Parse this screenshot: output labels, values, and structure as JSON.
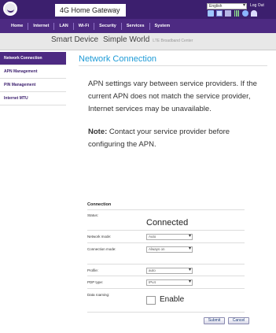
{
  "header": {
    "product_title": "4G Home Gateway",
    "language": "English",
    "logout": "Log Out",
    "status_icons": [
      "sim-icon",
      "mail-icon",
      "sd-icon",
      "signal-icon",
      "globe-icon",
      "wifi-icon"
    ]
  },
  "nav": {
    "items": [
      "Home",
      "Internet",
      "LAN",
      "Wi-Fi",
      "Security",
      "Services",
      "System"
    ],
    "active": "Internet"
  },
  "banner": {
    "part1": "Smart Device",
    "part2": "Simple World",
    "part3": "LTE Broadband Center"
  },
  "sidebar": {
    "items": [
      "Network Connection",
      "APN Management",
      "PIN Management",
      "Internet MTU"
    ],
    "active": "Network Connection"
  },
  "main": {
    "title": "Network Connection",
    "info": "APN settings vary between service providers. If the current APN does not match the service provider, Internet services may be unavailable.",
    "note_label": "Note:",
    "note_text": " Contact your service provider before configuring the APN."
  },
  "form": {
    "section_title": "Connection",
    "status_label": "Status:",
    "status_value": "Connected",
    "network_mode_label": "Network mode:",
    "network_mode_value": "Auto",
    "connection_mode_label": "Connection mode:",
    "connection_mode_value": "Always on",
    "profile_label": "Profile:",
    "profile_value": "auto",
    "pdp_type_label": "PDP type:",
    "pdp_type_value": "IPv4",
    "data_roaming_label": "Data roaming:",
    "data_roaming_value": "Enable",
    "submit_label": "Submit",
    "cancel_label": "Cancel"
  },
  "colors": {
    "header_bg": "#3c1f6e",
    "nav_bg": "#4d2a82",
    "accent": "#1e9bd7"
  }
}
